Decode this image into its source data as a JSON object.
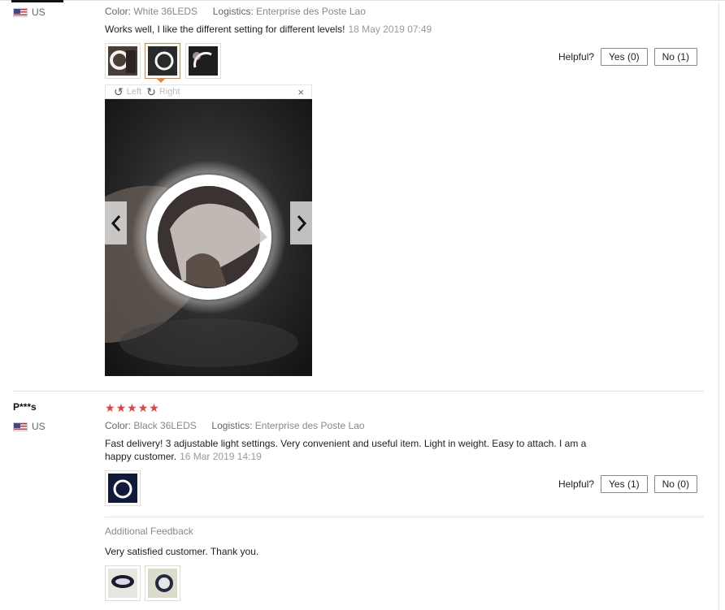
{
  "review1": {
    "country": "US",
    "color_key": "Color:",
    "color_value": "White 36LEDS",
    "logistics_key": "Logistics:",
    "logistics_value": "Enterprise des Poste Lao",
    "text": "Works well, I like the different setting for different levels!",
    "date": "18 May 2019 07:49",
    "helpful_label": "Helpful?",
    "yes_label": "Yes (0)",
    "no_label": "No (1)",
    "viewer": {
      "rotate_left": "Left",
      "rotate_right": "Right",
      "close": "×"
    }
  },
  "review2": {
    "name": "P***s",
    "stars": [
      "★",
      "★",
      "★",
      "★",
      "★"
    ],
    "rating": 5,
    "country": "US",
    "color_key": "Color:",
    "color_value": "Black 36LEDS",
    "logistics_key": "Logistics:",
    "logistics_value": "Enterprise des Poste Lao",
    "text_line1": "Fast delivery! 3 adjustable light settings. Very convenient and useful item. Light in weight. Easy to attach. I am a",
    "text_line2": "happy customer.",
    "date": "16 Mar 2019 14:19",
    "helpful_label": "Helpful?",
    "yes_label": "Yes (1)",
    "no_label": "No (0)",
    "additional_title": "Additional Feedback",
    "additional_text": "Very satisfied customer. Thank you."
  },
  "colors": {
    "star": "#e8413d",
    "selected_border": "#e8833a"
  }
}
